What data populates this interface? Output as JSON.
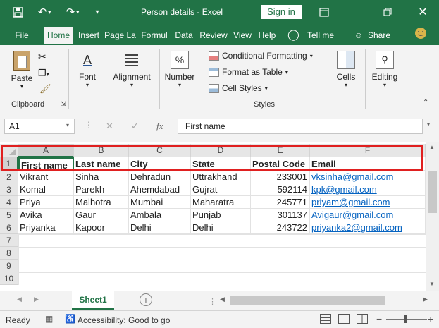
{
  "window": {
    "title": "Person details  -  Excel",
    "sign_in": "Sign in"
  },
  "tabs": [
    "File",
    "Home",
    "Insert",
    "Page La",
    "Formul",
    "Data",
    "Review",
    "View",
    "Help"
  ],
  "tell_me": "Tell me",
  "share": "Share",
  "ribbon": {
    "paste": "Paste",
    "clipboard": "Clipboard",
    "font": "Font",
    "alignment": "Alignment",
    "number": "Number",
    "conditional_formatting": "Conditional Formatting",
    "format_as_table": "Format as Table",
    "cell_styles": "Cell Styles",
    "styles": "Styles",
    "cells": "Cells",
    "editing": "Editing"
  },
  "formula_bar": {
    "name_box": "A1",
    "fx": "fx",
    "value": "First name"
  },
  "columns": [
    "A",
    "B",
    "C",
    "D",
    "E",
    "F"
  ],
  "rows": [
    "1",
    "2",
    "3",
    "4",
    "5",
    "6",
    "7",
    "8",
    "9",
    "10"
  ],
  "table": {
    "headers": [
      "First name",
      "Last name",
      "City",
      "State",
      "Postal Code",
      "Email"
    ],
    "rows": [
      [
        "Vikrant",
        "Sinha",
        "Dehradun",
        "Uttrakhand",
        "233001",
        "vksinha@gmail.com"
      ],
      [
        "Komal",
        "Parekh",
        "Ahemdabad",
        "Gujrat",
        "592114",
        "kpk@gmail.com"
      ],
      [
        "Priya",
        "Malhotra",
        "Mumbai",
        "Maharatra",
        "245771",
        "priyam@gmail.com"
      ],
      [
        "Avika",
        "Gaur",
        "Ambala",
        "Punjab",
        "301137",
        "Avigaur@gmail.com"
      ],
      [
        "Priyanka",
        "Kapoor",
        "Delhi",
        "Delhi",
        "243722",
        "priyanka2@gmail.com"
      ]
    ]
  },
  "sheet_tab": "Sheet1",
  "status": {
    "ready": "Ready",
    "accessibility": "Accessibility: Good to go"
  },
  "colors": {
    "excel_green": "#217346",
    "highlight": "#e02020",
    "link": "#0563c1"
  }
}
